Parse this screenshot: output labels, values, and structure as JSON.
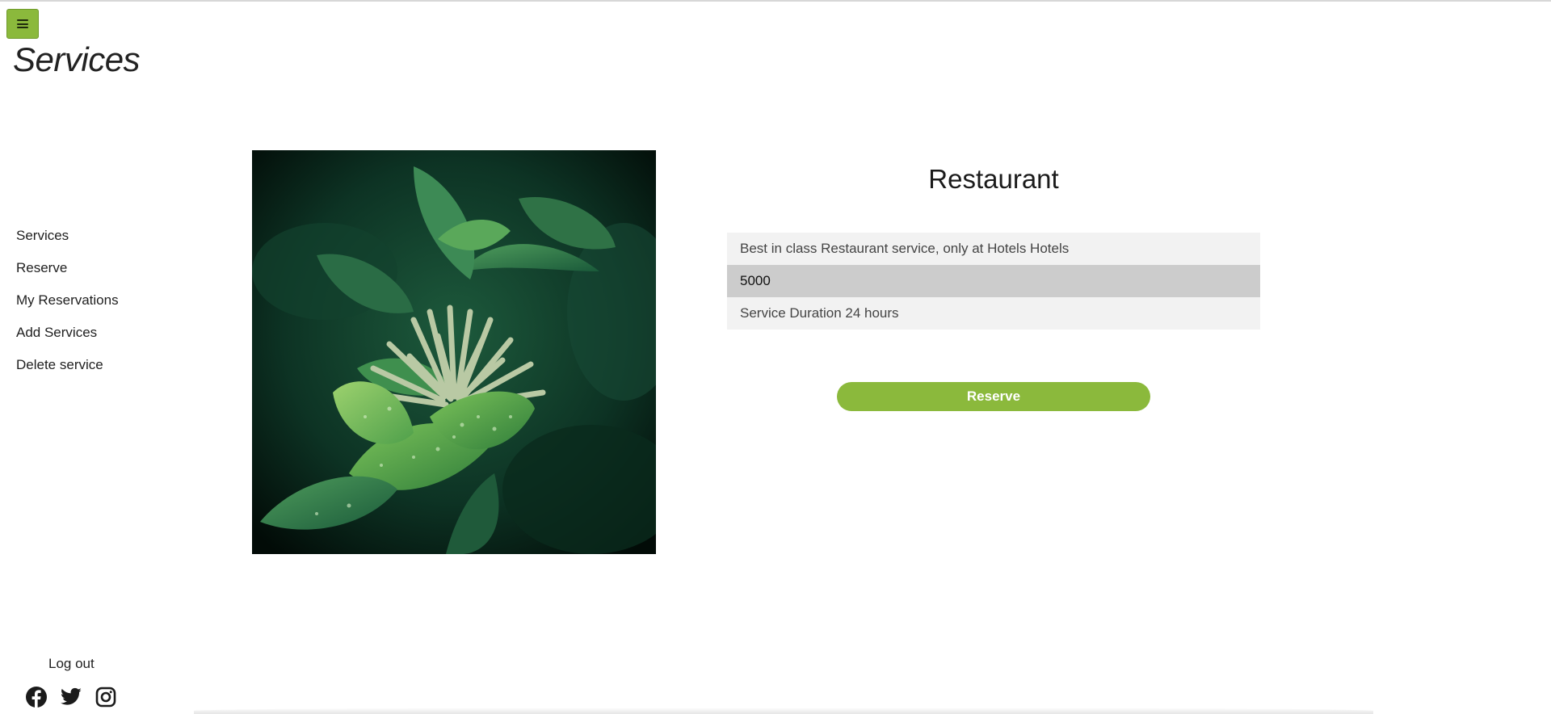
{
  "header": {
    "menu_icon": "hamburger-icon",
    "page_title": "Services"
  },
  "sidebar": {
    "items": [
      {
        "label": "Services"
      },
      {
        "label": "Reserve"
      },
      {
        "label": "My Reservations"
      },
      {
        "label": "Add Services"
      },
      {
        "label": "Delete service"
      }
    ],
    "logout_label": "Log out",
    "socials": [
      {
        "icon": "facebook-icon"
      },
      {
        "icon": "twitter-icon"
      },
      {
        "icon": "instagram-icon"
      }
    ]
  },
  "service": {
    "image_icon": "plant-photo",
    "name": "Restaurant",
    "description": "Best in class Restaurant service, only at Hotels Hotels",
    "price": "5000",
    "duration": "Service Duration 24 hours",
    "reserve_label": "Reserve"
  },
  "colors": {
    "accent": "#8bb93c",
    "price_row": "#cccccc",
    "detail_row": "#f2f2f2"
  }
}
